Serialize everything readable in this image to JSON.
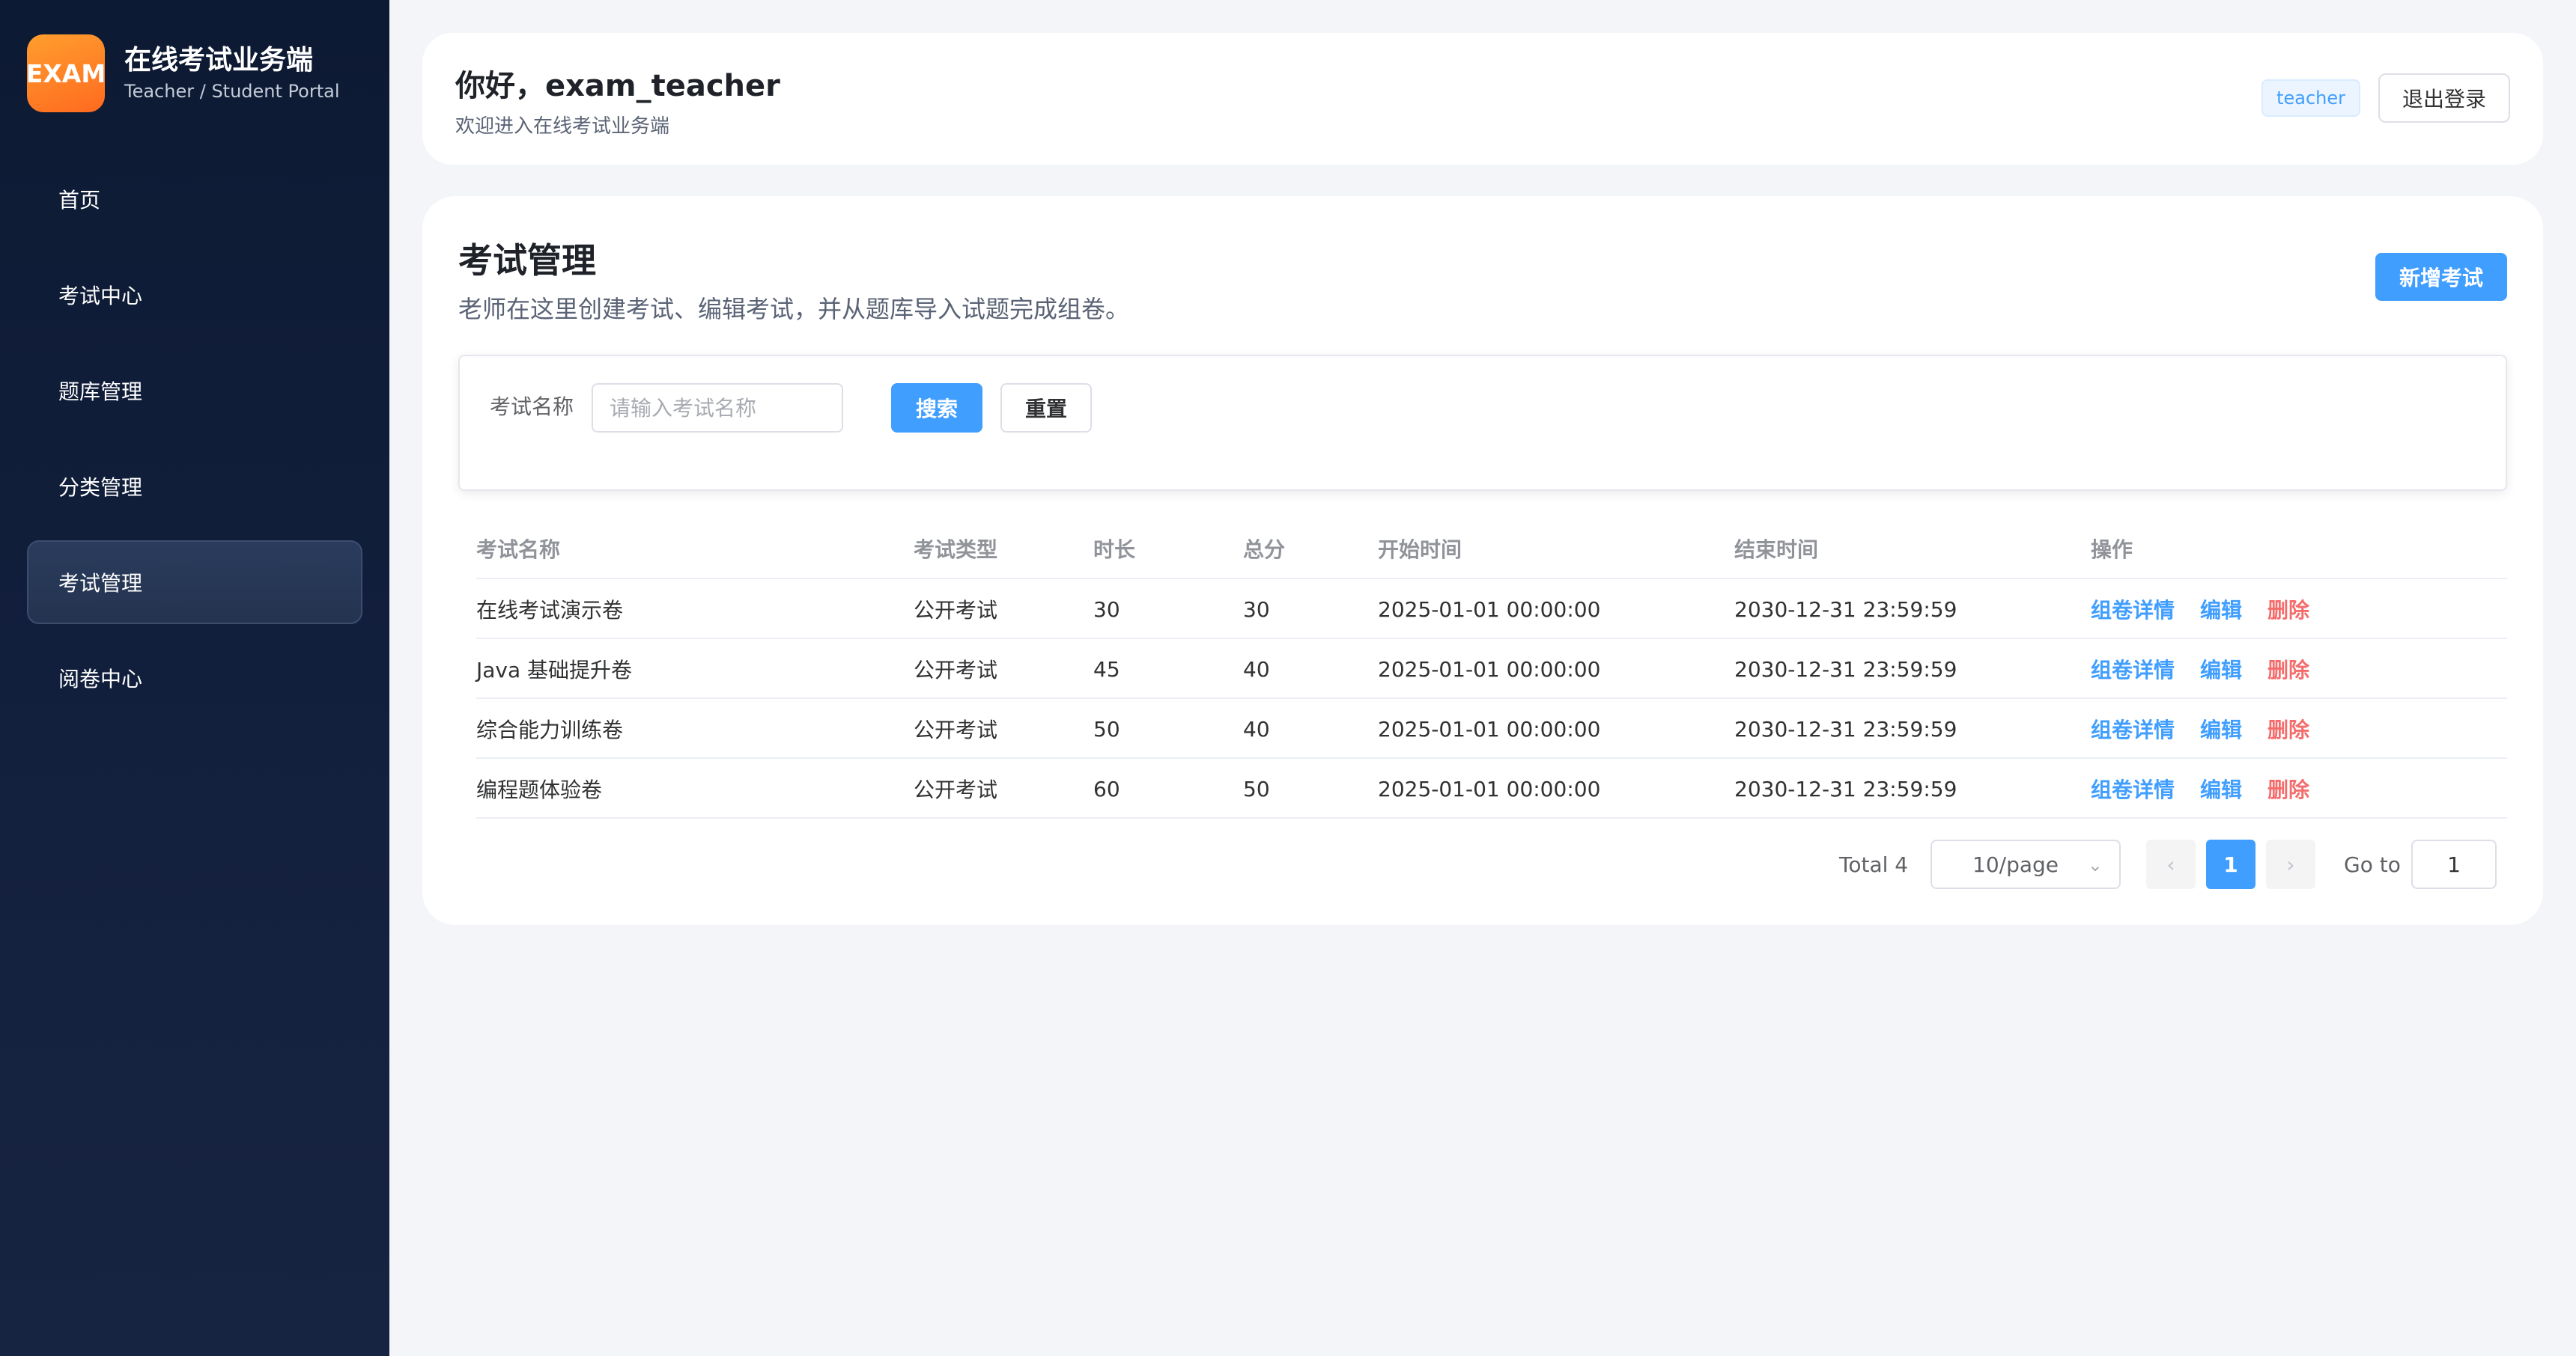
{
  "brand": {
    "logo_text": "EXAM",
    "title": "在线考试业务端",
    "subtitle": "Teacher / Student Portal"
  },
  "sidebar": {
    "items": [
      {
        "label": "首页"
      },
      {
        "label": "考试中心"
      },
      {
        "label": "题库管理"
      },
      {
        "label": "分类管理"
      },
      {
        "label": "考试管理",
        "active": true
      },
      {
        "label": "阅卷中心"
      }
    ]
  },
  "header": {
    "greeting": "你好，exam_teacher",
    "welcome": "欢迎进入在线考试业务端",
    "role_tag": "teacher",
    "logout_label": "退出登录"
  },
  "main": {
    "title": "考试管理",
    "description": "老师在这里创建考试、编辑考试，并从题库导入试题完成组卷。",
    "add_label": "新增考试",
    "search": {
      "label": "考试名称",
      "placeholder": "请输入考试名称",
      "value": "",
      "search_label": "搜索",
      "reset_label": "重置"
    },
    "table": {
      "columns": [
        "考试名称",
        "考试类型",
        "时长",
        "总分",
        "开始时间",
        "结束时间",
        "操作"
      ],
      "rows": [
        {
          "name": "在线考试演示卷",
          "type": "公开考试",
          "duration": "30",
          "score": "30",
          "start": "2025-01-01 00:00:00",
          "end": "2030-12-31 23:59:59"
        },
        {
          "name": "Java 基础提升卷",
          "type": "公开考试",
          "duration": "45",
          "score": "40",
          "start": "2025-01-01 00:00:00",
          "end": "2030-12-31 23:59:59"
        },
        {
          "name": "综合能力训练卷",
          "type": "公开考试",
          "duration": "50",
          "score": "40",
          "start": "2025-01-01 00:00:00",
          "end": "2030-12-31 23:59:59"
        },
        {
          "name": "编程题体验卷",
          "type": "公开考试",
          "duration": "60",
          "score": "50",
          "start": "2025-01-01 00:00:00",
          "end": "2030-12-31 23:59:59"
        }
      ],
      "actions": {
        "detail": "组卷详情",
        "edit": "编辑",
        "delete": "删除"
      }
    },
    "pagination": {
      "total": "Total 4",
      "page_size": "10/page",
      "current_page": "1",
      "goto_label": "Go to",
      "goto_value": "1"
    }
  },
  "colors": {
    "primary": "#409eff",
    "danger": "#f56c6c",
    "sidebar_bg": "#0d1a33",
    "logo_orange": "#ff7a22"
  }
}
